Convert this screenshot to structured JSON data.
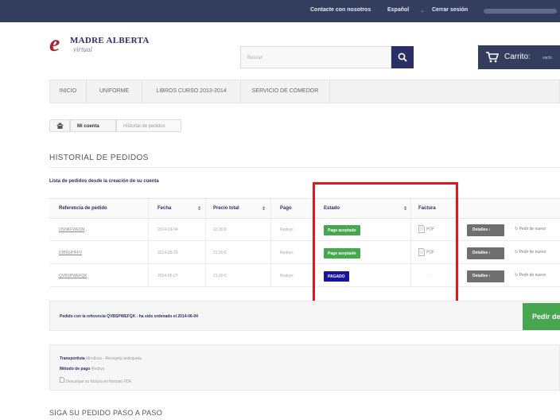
{
  "topbar": {
    "contact": "Contacte con nosotros",
    "language": "Español",
    "language_caret": "⌄",
    "logout": "Cerrar sesión"
  },
  "logo": {
    "mark": "e",
    "name": "MADRE ALBERTA",
    "sub": "virtual"
  },
  "search": {
    "placeholder": "Buscar"
  },
  "cart": {
    "label": "Carrito:",
    "status": "vacío"
  },
  "menu": [
    "INICIO",
    "UNIFORME",
    "LIBROS CURSO 2013-2014",
    "SERVICIO DE COMEDOR"
  ],
  "breadcrumb": {
    "account": "Mi cuenta",
    "current": "Historial de pedidos"
  },
  "page_title": "HISTORIAL DE PEDIDOS",
  "subtitle": "Lista de pedidos desde la creación de su cuenta",
  "table": {
    "headers": {
      "reference": "Referencia de pedido",
      "date": "Fecha",
      "total": "Precio total",
      "payment": "Pago",
      "status": "Estado",
      "invoice": "Factura"
    },
    "sort_glyph": "⇕",
    "rows": [
      {
        "reference": "OSNKFWESN",
        "date": "2014-09-04",
        "total": "22,00 €",
        "payment": "Redsys",
        "status": "Pago aceptado",
        "status_color": "#46a74e",
        "invoice": "PDF",
        "details": "Detalles",
        "reorder": "Pedir de nuevo"
      },
      {
        "reference": "IOBGUHFFV",
        "date": "2014-05-29",
        "total": "21,00 €",
        "payment": "Redsys",
        "status": "Pago aceptado",
        "status_color": "#46a74e",
        "invoice": "PDF",
        "details": "Detalles",
        "reorder": "Pedir de nuevo"
      },
      {
        "reference": "QVBSPWEFQK",
        "date": "2014-05-27",
        "total": "21,00 €",
        "payment": "Redsys",
        "status": "PAGADO",
        "status_color": "#16159c",
        "invoice": "-",
        "details": "Detalles",
        "reorder": "Pedir de nuevo"
      }
    ]
  },
  "notice": {
    "text": "Pedido con la referencia QVBSPWEFQK - ha sido ordenado el 2014-06-04",
    "button": "Pedir de nuevo"
  },
  "info": {
    "carrier_label": "Transportista",
    "carrier_value": "Mirolhuic - Recogida anticipada",
    "payment_label": "Método de pago",
    "payment_value": "Redsys",
    "download": "Descargar su factura en formato PDF."
  },
  "steps_title": "SIGA SU PEDIDO PASO A PASO",
  "colors": {
    "brand_navy": "#2a2f66",
    "topbar": "#333d5e",
    "highlight_red": "#e2161c",
    "status_green": "#46a74e",
    "status_blue": "#16159c"
  }
}
